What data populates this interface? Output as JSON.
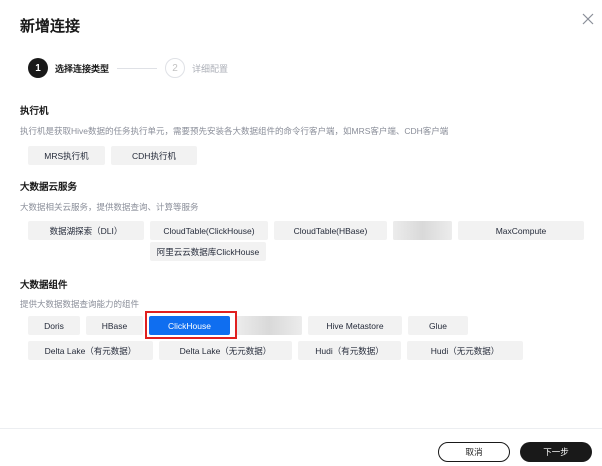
{
  "dialog": {
    "title": "新增连接"
  },
  "stepper": {
    "steps": [
      {
        "number": "1",
        "label": "选择连接类型"
      },
      {
        "number": "2",
        "label": "详细配置"
      }
    ]
  },
  "sections": {
    "executor": {
      "title": "执行机",
      "desc": "执行机是获取Hive数据的任务执行单元，需要预先安装各大数据组件的命令行客户端，如MRS客户端、CDH客户端",
      "items": [
        "MRS执行机",
        "CDH执行机"
      ]
    },
    "cloud": {
      "title": "大数据云服务",
      "desc": "大数据相关云服务，提供数据查询、计算等服务",
      "items": [
        "数据湖探索（DLI）",
        "CloudTable(ClickHouse)",
        "CloudTable(HBase)",
        "",
        "MaxCompute",
        "阿里云云数据库ClickHouse"
      ]
    },
    "components": {
      "title": "大数据组件",
      "desc": "提供大数据数据查询能力的组件",
      "items": [
        "Doris",
        "HBase",
        "ClickHouse",
        "",
        "Hive Metastore",
        "Glue",
        "Delta Lake（有元数据）",
        "Delta Lake（无元数据）",
        "Hudi（有元数据）",
        "Hudi（无元数据）"
      ]
    }
  },
  "footer": {
    "cancel_label": "取消",
    "next_label": "下一步"
  },
  "colors": {
    "selected": "#0f6ef0",
    "highlight": "#e02020",
    "primary_dark": "#191919"
  }
}
